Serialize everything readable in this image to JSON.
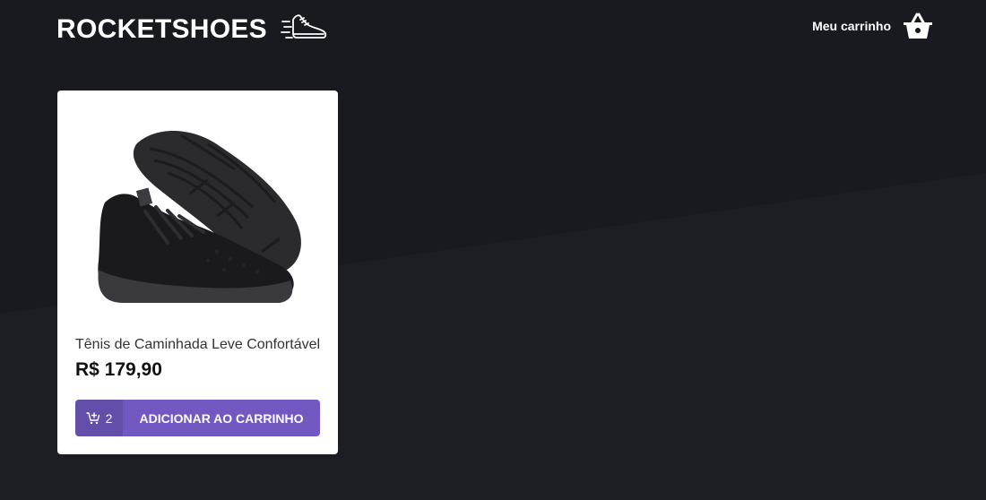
{
  "header": {
    "logo_text": "ROCKETSHOES",
    "logo_icon": "running-shoe-icon",
    "cart_label": "Meu carrinho",
    "cart_icon": "shopping-basket-icon"
  },
  "products": [
    {
      "title": "Tênis de Caminhada Leve Confortável",
      "price": "R$ 179,90",
      "quantity": "2",
      "button_label": "ADICIONAR AO CARRINHO",
      "image": "black-sneaker-image",
      "button_icon": "add-shopping-cart-icon"
    }
  ],
  "colors": {
    "background": "#191920",
    "background_lower": "#1d1e23",
    "accent": "#7159c1",
    "card": "#ffffff"
  }
}
